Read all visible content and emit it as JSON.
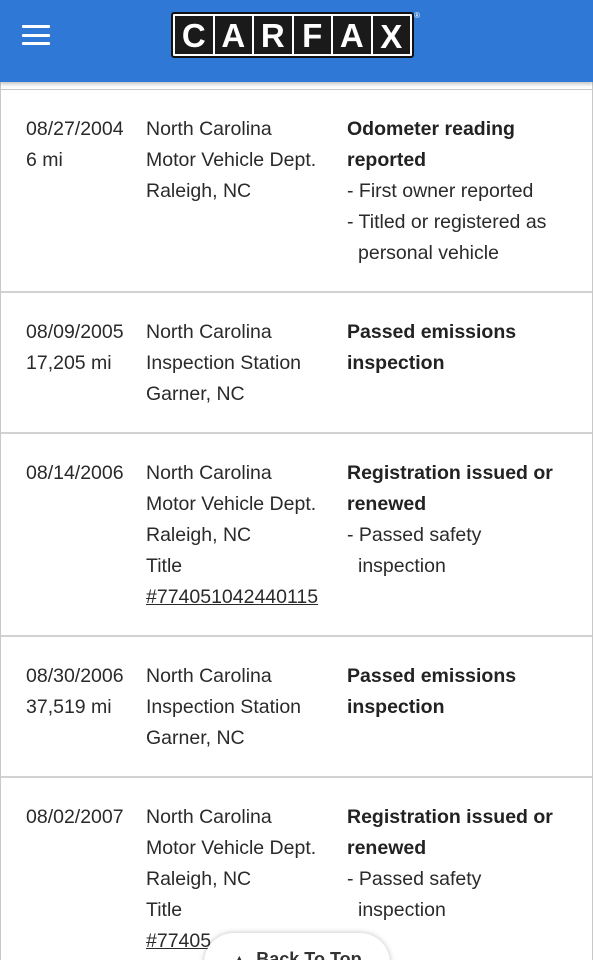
{
  "header": {
    "logo_letters": [
      "C",
      "A",
      "R",
      "F",
      "A",
      "X"
    ],
    "logo_reg": "®"
  },
  "records": [
    {
      "date": "08/27/2004",
      "mileage": "6 mi",
      "source": [
        "North Carolina",
        "Motor Vehicle Dept.",
        "Raleigh, NC"
      ],
      "comment_title": [
        "Odometer reading",
        "reported"
      ],
      "comment_items": [
        [
          "- First owner reported"
        ],
        [
          "- Titled or registered as",
          "personal vehicle"
        ]
      ]
    },
    {
      "date": "08/09/2005",
      "mileage": "17,205 mi",
      "source": [
        "North Carolina",
        "Inspection Station",
        "Garner, NC"
      ],
      "comment_title": [
        "Passed emissions",
        "inspection"
      ],
      "comment_items": []
    },
    {
      "date": "08/14/2006",
      "mileage": "",
      "source": [
        "North Carolina",
        "Motor Vehicle Dept.",
        "Raleigh, NC",
        "Title"
      ],
      "source_link": "#774051042440115",
      "comment_title": [
        "Registration issued or",
        "renewed"
      ],
      "comment_items": [
        [
          "- Passed safety",
          "inspection"
        ]
      ]
    },
    {
      "date": "08/30/2006",
      "mileage": "37,519 mi",
      "source": [
        "North Carolina",
        "Inspection Station",
        "Garner, NC"
      ],
      "comment_title": [
        "Passed emissions",
        "inspection"
      ],
      "comment_items": []
    },
    {
      "date": "08/02/2007",
      "mileage": "",
      "source": [
        "North Carolina",
        "Motor Vehicle Dept.",
        "Raleigh, NC",
        "Title"
      ],
      "source_link": "#77405",
      "comment_title": [
        "Registration issued or",
        "renewed"
      ],
      "comment_items": [
        [
          "- Passed safety",
          "inspection"
        ]
      ]
    }
  ],
  "back_to_top": {
    "label": "Back To Top",
    "icon": "arrow-up-icon"
  },
  "colors": {
    "header_bg": "#2f78d6",
    "divider": "#d2d2d2"
  }
}
